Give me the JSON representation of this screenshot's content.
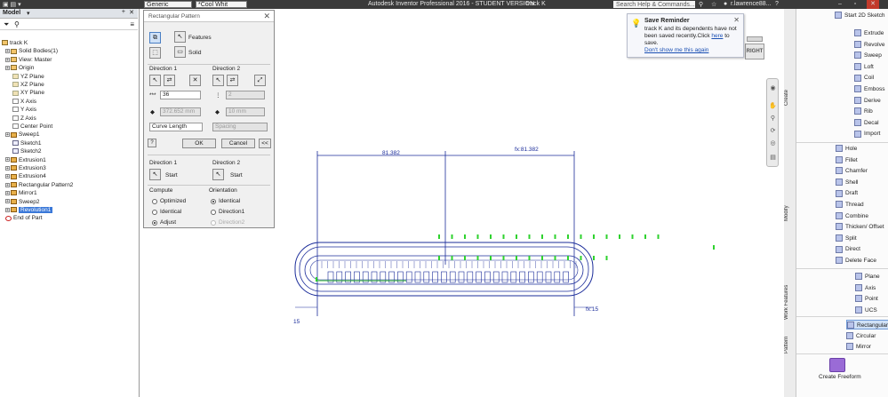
{
  "title_bar": {
    "style_combo": "Generic",
    "color_combo": "*Cool Whit",
    "app_title": "Autodesk Inventor Professional 2016 - STUDENT VERSION",
    "doc_name": "track K",
    "search_placeholder": "Search Help & Commands...",
    "user": "r.lawrence88..."
  },
  "browser": {
    "header": "Model",
    "tree": [
      {
        "label": "track K",
        "icon": "part-icon"
      },
      {
        "label": "Solid Bodies(1)",
        "icon": "folder-icon"
      },
      {
        "label": "View: Master",
        "icon": "view-icon"
      },
      {
        "label": "Origin",
        "icon": "folder-icon"
      },
      {
        "label": "YZ Plane",
        "icon": "plane-icon"
      },
      {
        "label": "XZ Plane",
        "icon": "plane-icon"
      },
      {
        "label": "XY Plane",
        "icon": "plane-icon"
      },
      {
        "label": "X Axis",
        "icon": "axis-icon"
      },
      {
        "label": "Y Axis",
        "icon": "axis-icon"
      },
      {
        "label": "Z Axis",
        "icon": "axis-icon"
      },
      {
        "label": "Center Point",
        "icon": "point-icon"
      },
      {
        "label": "Sweep1",
        "icon": "sweep-icon"
      },
      {
        "label": "Sketch1",
        "icon": "sketch-icon"
      },
      {
        "label": "Sketch2",
        "icon": "sketch-icon"
      },
      {
        "label": "Extrusion1",
        "icon": "extrude-icon"
      },
      {
        "label": "Extrusion3",
        "icon": "extrude-icon"
      },
      {
        "label": "Extrusion4",
        "icon": "extrude-icon"
      },
      {
        "label": "Rectangular Pattern2",
        "icon": "pattern-icon"
      },
      {
        "label": "Mirror1",
        "icon": "mirror-icon"
      },
      {
        "label": "Sweep2",
        "icon": "sweep-icon"
      },
      {
        "label": "Revolution1",
        "icon": "revolve-icon"
      },
      {
        "label": "End of Part",
        "icon": "end-of-part-icon"
      }
    ]
  },
  "dialog": {
    "title": "Rectangular Pattern",
    "features_label": "Features",
    "solid_label": "Solid",
    "dir1_label": "Direction 1",
    "dir2_label": "Direction 2",
    "count1_prefix": "***",
    "count1_value": "36",
    "count2_value": "2",
    "length1_value": "372.652 mm",
    "length2_value": "10 mm",
    "method1": "Curve Length",
    "method2": "Spacing",
    "ok": "OK",
    "cancel": "Cancel",
    "more": "<<",
    "start1_group": "Direction 1",
    "start2_group": "Direction 2",
    "start1": "Start",
    "start2": "Start",
    "compute_label": "Compute",
    "compute_options": [
      "Optimized",
      "Identical",
      "Adjust"
    ],
    "orientation_label": "Orientation",
    "orientation_options": [
      "Identical",
      "Direction1",
      "Direction2"
    ]
  },
  "viewport": {
    "dim_left": "81.382",
    "dim_right": "fx:81.382",
    "dim_bottom_left": "15",
    "dim_bottom_right": "fx:15",
    "viewcube_face": "RIGHT"
  },
  "reminder": {
    "title": "Save Reminder",
    "body1": "track K and its dependents have not",
    "body2": "been saved recently.Click",
    "link_here": "here",
    "body3": "to",
    "body4": "save.",
    "link_dont": "Don't show me this again"
  },
  "ribbon": {
    "top": "Start 2D Sketch",
    "tabs": [
      "Create",
      "Modify",
      "Work Features",
      "Pattern"
    ],
    "create": [
      "Extrude",
      "Revolve",
      "Sweep",
      "Loft",
      "Coil",
      "Emboss",
      "Derive",
      "Rib",
      "Decal",
      "Import"
    ],
    "modify": [
      "Hole",
      "Fillet",
      "Chamfer",
      "Shell",
      "Draft",
      "Thread",
      "Combine",
      "Thicken/ Offset",
      "Split",
      "Direct",
      "Delete Face"
    ],
    "work": [
      "Plane",
      "Axis",
      "Point",
      "UCS"
    ],
    "pattern": [
      "Rectangular",
      "Circular",
      "Mirror"
    ],
    "freeform": "Create Freeform"
  }
}
